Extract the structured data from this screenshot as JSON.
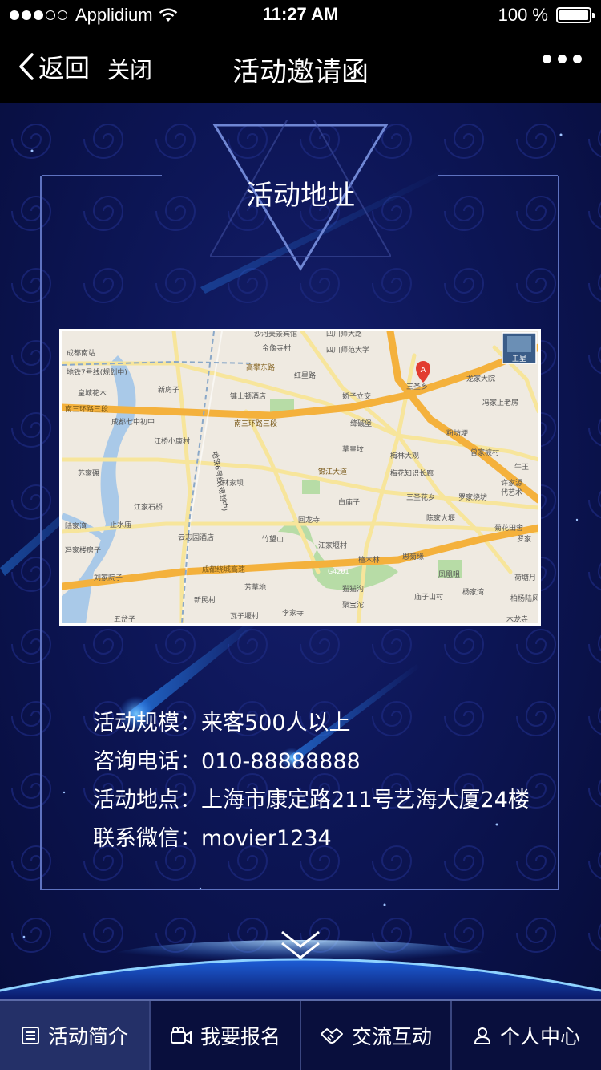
{
  "status_bar": {
    "carrier": "Applidium",
    "time": "11:27 AM",
    "battery": "100 %"
  },
  "nav": {
    "back_label": "返回",
    "close_label": "关闭",
    "title": "活动邀请函"
  },
  "section": {
    "title": "活动地址"
  },
  "map": {
    "marker_label": "A",
    "satellite_label": "卫星",
    "labels": {
      "l1": "沙河美景宾馆",
      "l2": "四川师大路",
      "l3": "四川师范大学",
      "l4": "金像寺村",
      "l5": "成都南站",
      "l6": "地铁7号线(规划中)",
      "l7": "高攀东路",
      "l8": "红星路",
      "l9": "新房子",
      "l10": "皇城花木",
      "l11": "镛士顿酒店",
      "l12": "娇子立交",
      "l13": "三圣乡",
      "l14": "龙家大院",
      "l15": "南三环路三段",
      "l16": "成都七中初中",
      "l17": "南三环路三段",
      "l18": "绛碱堡",
      "l19": "冯家上老房",
      "l20": "粉坊埂",
      "l21": "江桥小康村",
      "l22": "曾家坡村",
      "l23": "草皇坟",
      "l24": "梅林大观",
      "l25": "苏家碾",
      "l26": "林家坝",
      "l27": "锦江大道",
      "l28": "梅花知识长廊",
      "l29": "三圣花乡",
      "l30": "罗家烧坊",
      "l31": "江家石桥",
      "l32": "白庙子",
      "l33": "陈家大堰",
      "l34": "止水庙",
      "l35": "回龙寺",
      "l36": "陆家湾",
      "l37": "云志园酒店",
      "l38": "菊花田舍",
      "l39": "罗家",
      "l40": "冯家楼房子",
      "l41": "竹望山",
      "l42": "江家堰村",
      "l43": "檀木林",
      "l44": "思菊缘",
      "l45": "成都绕城高速",
      "l46": "G4201",
      "l47": "刘家院子",
      "l48": "凤凰咀",
      "l49": "荷塘月",
      "l50": "芳草地",
      "l51": "猫猫沟",
      "l52": "庙子山村",
      "l53": "杨家湾",
      "l54": "柏杨陆风",
      "l55": "新民村",
      "l56": "瓦子堰村",
      "l57": "李家寺",
      "l58": "聚宝沱",
      "l59": "木龙寺",
      "l60": "五岔子",
      "l61": "地铁6号线(规划中)",
      "l62": "牛王",
      "l63": "许家源",
      "l64": "代艺术"
    }
  },
  "info": {
    "scale_label": "活动规模：",
    "scale_value": "来客500人以上",
    "phone_label": "咨询电话：",
    "phone_value": "010-88888888",
    "address_label": "活动地点：",
    "address_value": "上海市康定路211号艺海大厦24楼",
    "wechat_label": "联系微信：",
    "wechat_value": "movier1234"
  },
  "tabs": [
    {
      "label": "活动简介",
      "icon": "list-icon",
      "active": true
    },
    {
      "label": "我要报名",
      "icon": "video-camera-icon",
      "active": false
    },
    {
      "label": "交流互动",
      "icon": "handshake-icon",
      "active": false
    },
    {
      "label": "个人中心",
      "icon": "user-icon",
      "active": false
    }
  ],
  "colors": {
    "background": "#0d1657",
    "frame_line": "#5e72c0",
    "accent_glow": "#3da6ff",
    "road_major": "#f4b13c",
    "road_minor": "#f7e59b",
    "map_land": "#efeae1",
    "map_water": "#a9c9e8",
    "map_green": "#b7dca6"
  }
}
